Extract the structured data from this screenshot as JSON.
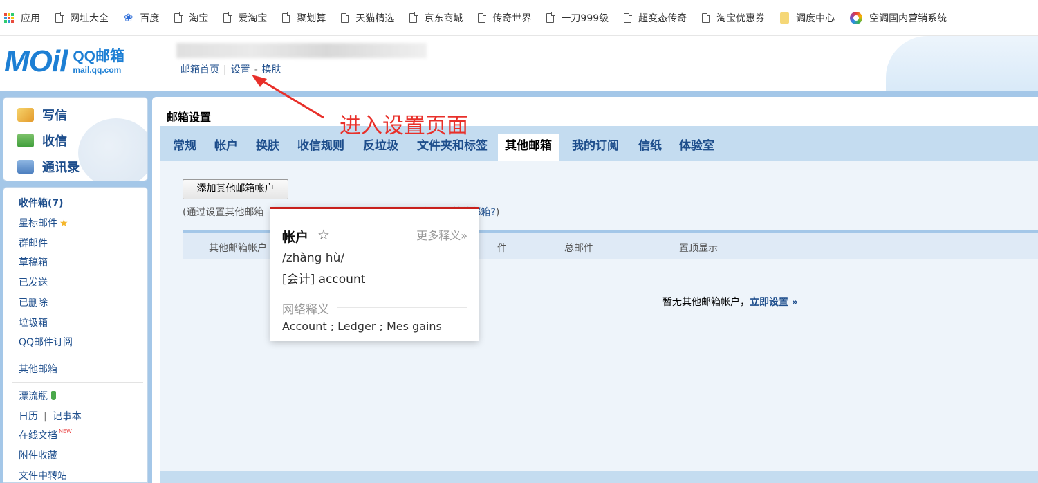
{
  "bookmarks": [
    {
      "label": "应用",
      "icon": "apps-grid-icon"
    },
    {
      "label": "网址大全",
      "icon": "page-icon"
    },
    {
      "label": "百度",
      "icon": "baidu-paw-icon"
    },
    {
      "label": "淘宝",
      "icon": "page-icon"
    },
    {
      "label": "爱淘宝",
      "icon": "page-icon"
    },
    {
      "label": "聚划算",
      "icon": "page-icon"
    },
    {
      "label": "天猫精选",
      "icon": "page-icon"
    },
    {
      "label": "京东商城",
      "icon": "page-icon"
    },
    {
      "label": "传奇世界",
      "icon": "page-icon"
    },
    {
      "label": "一刀999级",
      "icon": "page-icon"
    },
    {
      "label": "超变态传奇",
      "icon": "page-icon"
    },
    {
      "label": "淘宝优惠券",
      "icon": "page-icon"
    },
    {
      "label": "调度中心",
      "icon": "folder-icon"
    },
    {
      "label": "空调国内营销系统",
      "icon": "chrome-ring-icon"
    }
  ],
  "header": {
    "logo_text": "MOil",
    "logo_brand": "QQ邮箱",
    "logo_domain": "mail.qq.com",
    "links": {
      "home": "邮箱首页",
      "sep": "|",
      "settings": "设置",
      "dash": "-",
      "skin": "换肤"
    }
  },
  "annotation": {
    "text": "进入设置页面",
    "color": "#e8302a"
  },
  "sidebar": {
    "compose": "写信",
    "receive": "收信",
    "contacts": "通讯录",
    "folders": {
      "inbox": "收件箱(7)",
      "starred": "星标邮件",
      "group": "群邮件",
      "drafts": "草稿箱",
      "sent": "已发送",
      "deleted": "已删除",
      "spam": "垃圾箱",
      "subscriptions": "QQ邮件订阅",
      "other_mailbox": "其他邮箱",
      "drift_bottle": "漂流瓶",
      "calendar": "日历",
      "cal_sep": "|",
      "notepad": "记事本",
      "online_docs": "在线文档",
      "new_badge": "NEW",
      "attachments": "附件收藏",
      "file_transfer": "文件中转站"
    }
  },
  "content": {
    "title": "邮箱设置",
    "tabs": [
      "常规",
      "帐户",
      "换肤",
      "收信规则",
      "反垃圾",
      "文件夹和标签",
      "其他邮箱",
      "我的订阅",
      "信纸",
      "体验室"
    ],
    "active_tab": "其他邮箱",
    "add_button": "添加其他邮箱帐户",
    "hint_prefix": "(通过设置其他邮箱",
    "hint_link": "什么是其他邮箱?",
    "hint_suffix": ")",
    "table_headers": [
      "其他邮箱帐户",
      "件",
      "总邮件",
      "置顶显示"
    ],
    "empty_text": "暂无其他邮箱帐户，",
    "empty_link": "立即设置 »"
  },
  "dictionary": {
    "word": "帐户",
    "more": "更多释义»",
    "phonetic": "/zhàng hù/",
    "definition": "[会计] account",
    "web_title": "网络释义",
    "web_definition": "Account ; Ledger ; Mes gains"
  },
  "colors": {
    "accent_blue": "#1e4e8c",
    "frame_blue": "#a4c7e8",
    "tab_blue": "#c4dcf0",
    "popup_red": "#c8201c"
  }
}
